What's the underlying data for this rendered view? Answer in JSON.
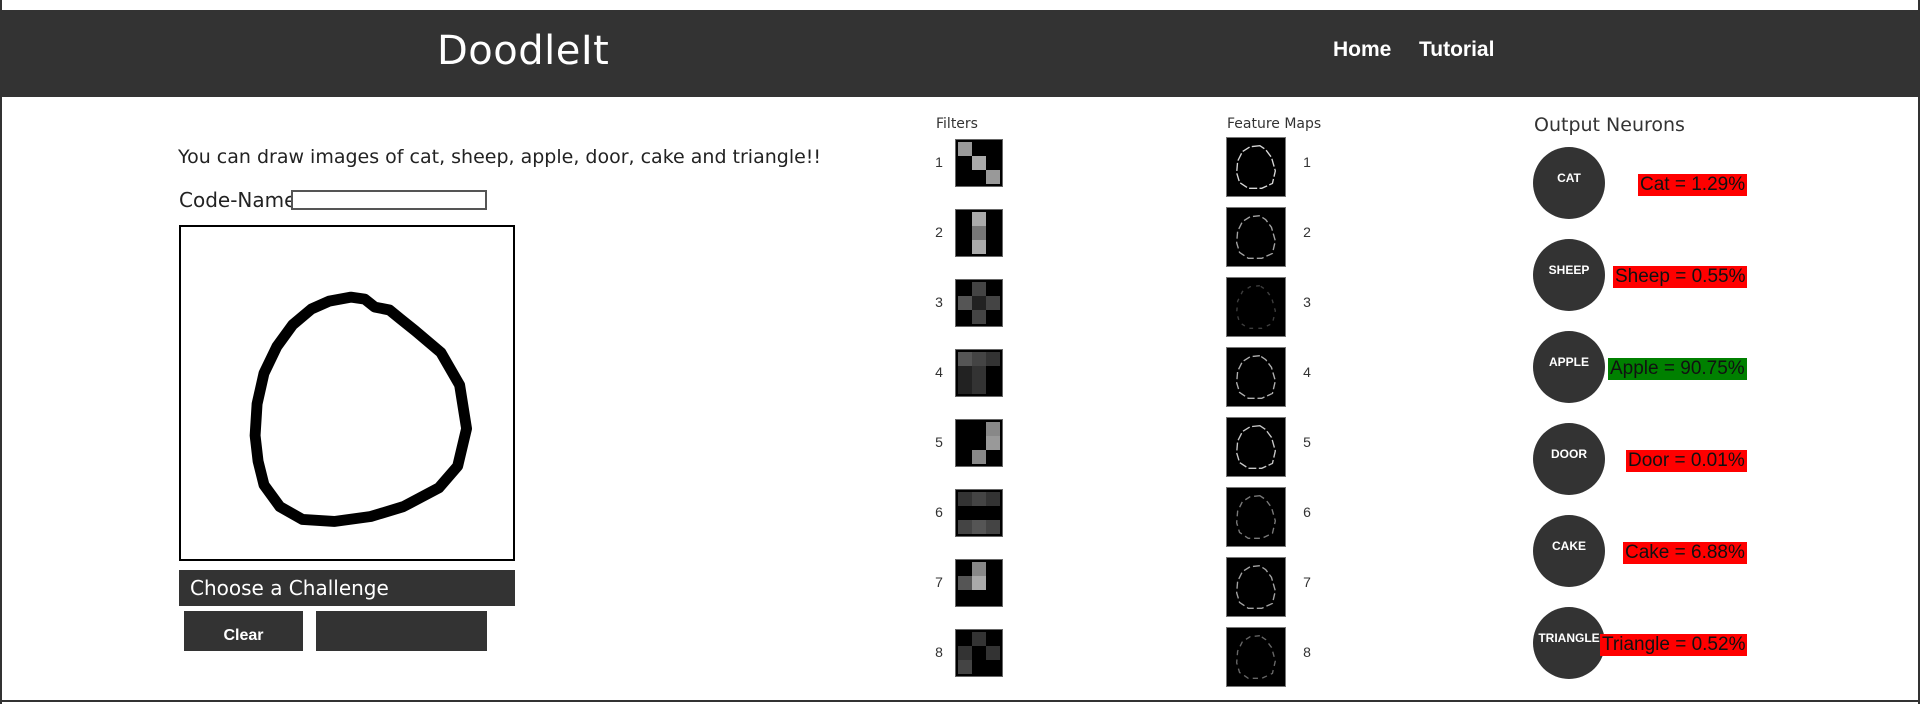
{
  "header": {
    "brand": "DoodleIt",
    "nav": [
      {
        "label": "Home"
      },
      {
        "label": "Tutorial"
      }
    ]
  },
  "drawing": {
    "intro_text": "You can draw images of cat, sheep, apple, door, cake and triangle!!",
    "codename_label": "Code-Name :",
    "codename_value": "",
    "challenge_button": "Choose a Challenge",
    "clear_button": "Clear",
    "second_button": ""
  },
  "filters": {
    "title": "Filters",
    "items": [
      {
        "index": "1",
        "cells": [
          "#999",
          "#000",
          "#000",
          "#000",
          "#aaa",
          "#000",
          "#000",
          "#000",
          "#999"
        ]
      },
      {
        "index": "2",
        "cells": [
          "#000",
          "#aaa",
          "#000",
          "#000",
          "#777",
          "#000",
          "#000",
          "#aaa",
          "#000"
        ]
      },
      {
        "index": "3",
        "cells": [
          "#000",
          "#444",
          "#000",
          "#555",
          "#222",
          "#444",
          "#000",
          "#444",
          "#000"
        ]
      },
      {
        "index": "4",
        "cells": [
          "#555",
          "#444",
          "#333",
          "#222",
          "#333",
          "#000",
          "#222",
          "#333",
          "#000"
        ]
      },
      {
        "index": "5",
        "cells": [
          "#000",
          "#000",
          "#888",
          "#000",
          "#000",
          "#999",
          "#000",
          "#888",
          "#000"
        ]
      },
      {
        "index": "6",
        "cells": [
          "#333",
          "#444",
          "#333",
          "#000",
          "#000",
          "#000",
          "#444",
          "#555",
          "#444"
        ]
      },
      {
        "index": "7",
        "cells": [
          "#000",
          "#888",
          "#000",
          "#555",
          "#aaa",
          "#000",
          "#000",
          "#000",
          "#000"
        ]
      },
      {
        "index": "8",
        "cells": [
          "#000",
          "#333",
          "#000",
          "#333",
          "#000",
          "#333",
          "#444",
          "#000",
          "#000"
        ]
      }
    ]
  },
  "feature_maps": {
    "title": "Feature Maps",
    "items": [
      {
        "index": "1",
        "intensity": 0.9
      },
      {
        "index": "2",
        "intensity": 0.7
      },
      {
        "index": "3",
        "intensity": 0.15
      },
      {
        "index": "4",
        "intensity": 0.75
      },
      {
        "index": "5",
        "intensity": 0.85
      },
      {
        "index": "6",
        "intensity": 0.5
      },
      {
        "index": "7",
        "intensity": 0.7
      },
      {
        "index": "8",
        "intensity": 0.4
      }
    ]
  },
  "outputs": {
    "title": "Output Neurons",
    "neurons": [
      {
        "label": "CAT",
        "result": "Cat = 1.29%",
        "color": "#ff0000"
      },
      {
        "label": "SHEEP",
        "result": "Sheep = 0.55%",
        "color": "#ff0000"
      },
      {
        "label": "APPLE",
        "result": "Apple = 90.75%",
        "color": "#008000"
      },
      {
        "label": "DOOR",
        "result": "Door = 0.01%",
        "color": "#ff0000"
      },
      {
        "label": "CAKE",
        "result": "Cake = 6.88%",
        "color": "#ff0000"
      },
      {
        "label": "TRIANGLE",
        "result": "Triangle = 0.52%",
        "color": "#ff0000"
      }
    ]
  },
  "colors": {
    "header_bg": "#333333",
    "button_bg": "#333333",
    "wrong": "#ff0000",
    "right": "#008000"
  }
}
